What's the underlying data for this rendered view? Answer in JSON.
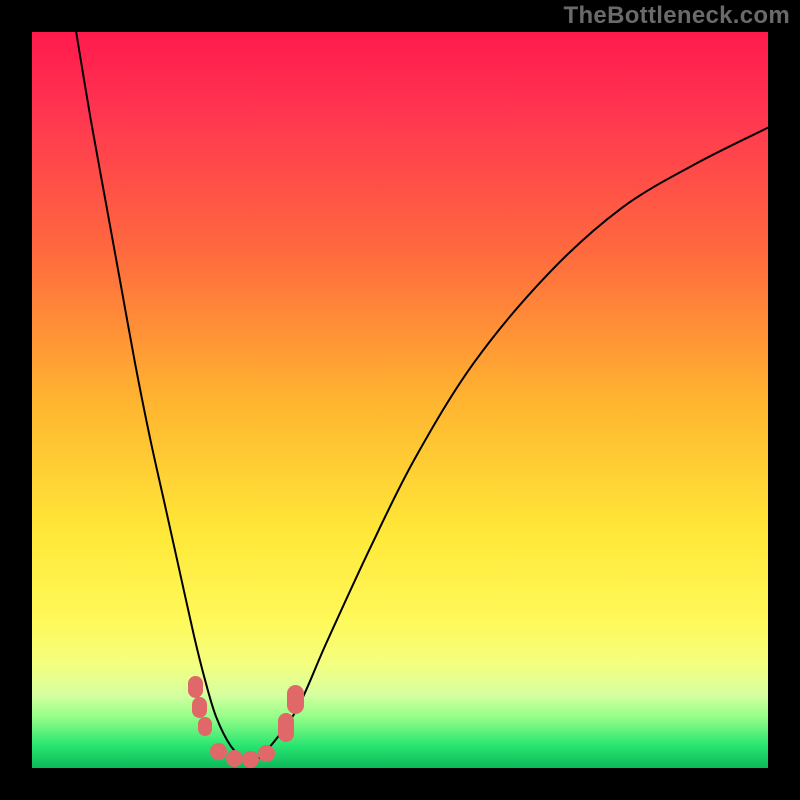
{
  "watermark": "TheBottleneck.com",
  "chart_data": {
    "type": "line",
    "title": "",
    "xlabel": "",
    "ylabel": "",
    "xlim": [
      0,
      100
    ],
    "ylim": [
      0,
      100
    ],
    "gradient_stops": [
      {
        "pct": 0,
        "color": "#ff1a4d"
      },
      {
        "pct": 12,
        "color": "#ff3850"
      },
      {
        "pct": 30,
        "color": "#ff6a3e"
      },
      {
        "pct": 50,
        "color": "#ffb430"
      },
      {
        "pct": 68,
        "color": "#ffe838"
      },
      {
        "pct": 80,
        "color": "#fff95a"
      },
      {
        "pct": 86,
        "color": "#f3ff80"
      },
      {
        "pct": 90,
        "color": "#d6ffa0"
      },
      {
        "pct": 93,
        "color": "#96ff8a"
      },
      {
        "pct": 97,
        "color": "#28e470"
      },
      {
        "pct": 100,
        "color": "#0cb95a"
      }
    ],
    "series": [
      {
        "name": "bottleneck-curve",
        "x": [
          6,
          8,
          10,
          12,
          14,
          16,
          18,
          20,
          22,
          23.5,
          25,
          27,
          29,
          30.5,
          32,
          36,
          40,
          46,
          52,
          60,
          70,
          80,
          90,
          100
        ],
        "y": [
          100,
          88,
          77,
          66,
          55,
          45,
          36,
          27,
          18,
          12,
          7,
          3,
          1.2,
          1.2,
          2.5,
          8,
          17,
          30,
          42,
          55,
          67,
          76,
          82,
          87
        ]
      }
    ],
    "markers": [
      {
        "x": 22.2,
        "y": 11.0,
        "w": 2.0,
        "h": 3.0
      },
      {
        "x": 22.8,
        "y": 8.2,
        "w": 2.0,
        "h": 2.8
      },
      {
        "x": 23.5,
        "y": 5.6,
        "w": 2.0,
        "h": 2.6
      },
      {
        "x": 25.3,
        "y": 2.3,
        "w": 2.3,
        "h": 2.3
      },
      {
        "x": 27.5,
        "y": 1.3,
        "w": 2.3,
        "h": 2.3
      },
      {
        "x": 29.7,
        "y": 1.2,
        "w": 2.3,
        "h": 2.3
      },
      {
        "x": 31.8,
        "y": 2.0,
        "w": 2.3,
        "h": 2.3
      },
      {
        "x": 34.5,
        "y": 5.5,
        "w": 2.2,
        "h": 4.0
      },
      {
        "x": 35.8,
        "y": 9.3,
        "w": 2.2,
        "h": 4.0
      }
    ],
    "curve_stroke": "#000000",
    "curve_width": 2
  }
}
